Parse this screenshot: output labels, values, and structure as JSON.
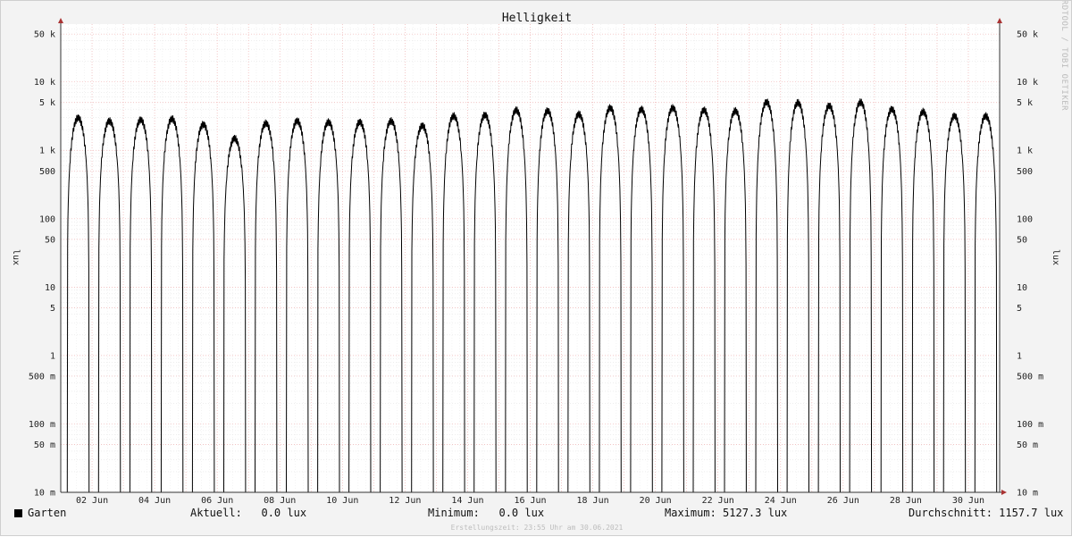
{
  "chart_data": {
    "type": "line",
    "title": "Helligkeit",
    "ylabel": "lux",
    "yscale": "log",
    "ylim": [
      0.01,
      70000
    ],
    "xlim": [
      1,
      31
    ],
    "x_tick_labels": [
      "02 Jun",
      "04 Jun",
      "06 Jun",
      "08 Jun",
      "10 Jun",
      "12 Jun",
      "14 Jun",
      "16 Jun",
      "18 Jun",
      "20 Jun",
      "22 Jun",
      "24 Jun",
      "26 Jun",
      "28 Jun",
      "30 Jun"
    ],
    "x_tick_days": [
      2,
      4,
      6,
      8,
      10,
      12,
      14,
      16,
      18,
      20,
      22,
      24,
      26,
      28,
      30
    ],
    "y_ticks": [
      {
        "value": 50000,
        "label": "50 k"
      },
      {
        "value": 10000,
        "label": "10 k"
      },
      {
        "value": 5000,
        "label": "5 k"
      },
      {
        "value": 1000,
        "label": "1 k"
      },
      {
        "value": 500,
        "label": "500"
      },
      {
        "value": 100,
        "label": "100"
      },
      {
        "value": 50,
        "label": "50"
      },
      {
        "value": 10,
        "label": "10"
      },
      {
        "value": 5,
        "label": "5"
      },
      {
        "value": 1,
        "label": "1"
      },
      {
        "value": 0.5,
        "label": "500 m"
      },
      {
        "value": 0.1,
        "label": "100 m"
      },
      {
        "value": 0.05,
        "label": "50 m"
      },
      {
        "value": 0.01,
        "label": "10 m"
      }
    ],
    "grid": true,
    "series": [
      {
        "name": "Garten",
        "color": "#000000",
        "daily_peak_lux": [
          3000,
          2700,
          2800,
          2900,
          2400,
          1500,
          2500,
          2700,
          2600,
          2600,
          2700,
          2300,
          3200,
          3300,
          3900,
          3800,
          3400,
          4200,
          4000,
          4200,
          3900,
          3800,
          5100,
          5000,
          4500,
          5100,
          4000,
          3700,
          3200,
          3200
        ]
      }
    ]
  },
  "legend": {
    "series_label": "Garten",
    "current_label": "Aktuell:",
    "current_value": "0.0 lux",
    "minimum_label": "Minimum:",
    "minimum_value": "0.0 lux",
    "maximum_label": "Maximum:",
    "maximum_value": "5127.3 lux",
    "average_label": "Durchschnitt:",
    "average_value": "1157.7 lux"
  },
  "credit": "Erstellungszeit: 23:55 Uhr am 30.06.2021",
  "side_text": "RRDTOOL / TOBI OETIKER"
}
